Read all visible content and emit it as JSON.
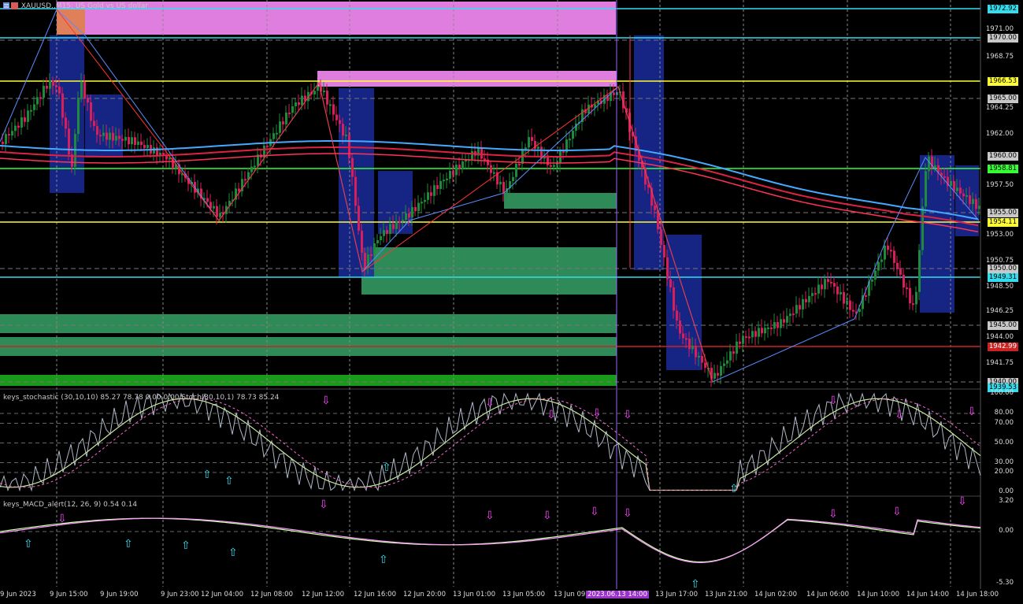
{
  "chart_title": "XAUUSD.,M15: US Gold vs US dollar",
  "colors": {
    "background": "#000000",
    "bull_candle": "#1f8a3a",
    "bear_candle": "#d81f5c",
    "zone_pink": "#e07ee0",
    "zone_green": "#2e8b57",
    "box_blue": "#1a2a9a",
    "level_yellow": "#ffff33",
    "level_cyan": "#33ddee",
    "level_green": "#33ff33",
    "level_red": "#cc2222",
    "stoch_main": "#c8e6a0",
    "stoch_signal": "#ff66cc",
    "macd_main": "#ff99ff",
    "macd_signal": "#ccffaa"
  },
  "price_axis": {
    "ticks": [
      "1971.00",
      "1968.75",
      "1964.25",
      "1962.00",
      "1957.50",
      "1953.00",
      "1950.75",
      "1948.50",
      "1946.25",
      "1944.00",
      "1941.75"
    ],
    "tags": [
      {
        "label": "1972.92",
        "style": "cyan"
      },
      {
        "label": "1970.00",
        "style": "grey"
      },
      {
        "label": "1966.53",
        "style": "yellow"
      },
      {
        "label": "1965.00",
        "style": "grey"
      },
      {
        "label": "1960.00",
        "style": "grey"
      },
      {
        "label": "1958.81",
        "style": "green"
      },
      {
        "label": "1955.00",
        "style": "grey"
      },
      {
        "label": "1954.11",
        "style": "yellow"
      },
      {
        "label": "1950.00",
        "style": "grey"
      },
      {
        "label": "1949.31",
        "style": "cyan"
      },
      {
        "label": "1945.00",
        "style": "grey"
      },
      {
        "label": "1942.99",
        "style": "red"
      },
      {
        "label": "1940.00",
        "style": "grey"
      },
      {
        "label": "1939.53",
        "style": "cyan"
      }
    ]
  },
  "time_axis": {
    "labels": [
      "9 Jun 2023",
      "9 Jun 15:00",
      "9 Jun 19:00",
      "9 Jun 23:00",
      "12 Jun 04:00",
      "12 Jun 08:00",
      "12 Jun 12:00",
      "12 Jun 16:00",
      "12 Jun 20:00",
      "13 Jun 01:00",
      "13 Jun 05:00",
      "13 Jun 09",
      "13 Jun 17:00",
      "13 Jun 21:00",
      "14 Jun 02:00",
      "14 Jun 06:00",
      "14 Jun 10:00",
      "14 Jun 14:00",
      "14 Jun 18:00"
    ],
    "cursor_label": "2023.06.13 14:00"
  },
  "stochastic": {
    "title": "keys_stochastic (30,10,10) 85.27 78.78 0.00 0.00 Stoch(30,10,1) 78.73 85.24",
    "ticks": [
      "100.00",
      "80.00",
      "70.00",
      "50.00",
      "30.00",
      "20.00",
      "0.00"
    ]
  },
  "macd": {
    "title": "keys_MACD_alert(12, 26, 9) 0.54 0.14",
    "ticks": [
      "3.20",
      "0.00",
      "-5.30"
    ]
  },
  "icons": {
    "down_arrow": "down-arrow-icon",
    "up_arrow": "up-arrow-icon",
    "chart_type": "chart-type-icon"
  }
}
